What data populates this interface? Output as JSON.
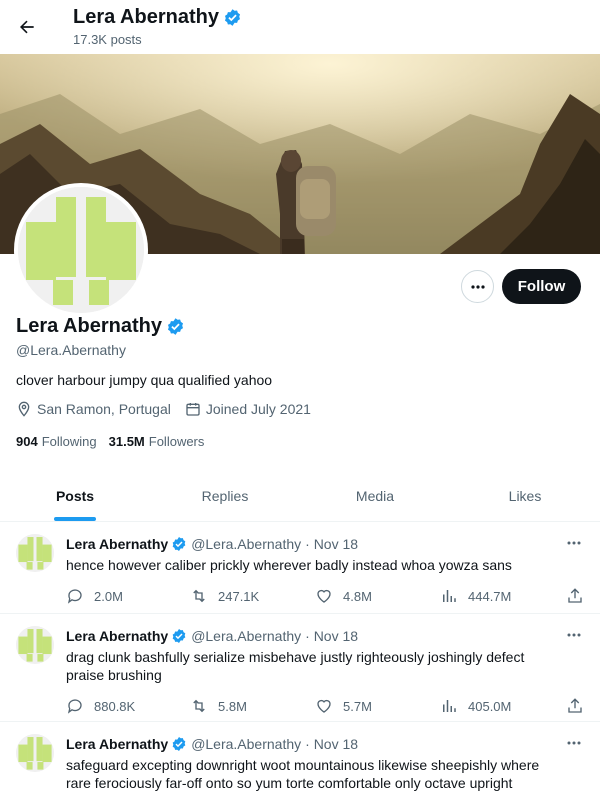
{
  "header": {
    "name": "Lera Abernathy",
    "posts_count": "17.3K posts"
  },
  "profile": {
    "name": "Lera Abernathy",
    "handle": "@Lera.Abernathy",
    "bio": "clover harbour jumpy qua qualified yahoo",
    "location": "San Ramon, Portugal",
    "joined": "Joined July 2021",
    "following_count": "904",
    "following_label": "Following",
    "followers_count": "31.5M",
    "followers_label": "Followers",
    "follow_button": "Follow"
  },
  "tabs": [
    {
      "label": "Posts",
      "active": true
    },
    {
      "label": "Replies"
    },
    {
      "label": "Media"
    },
    {
      "label": "Likes"
    }
  ],
  "posts": [
    {
      "name": "Lera Abernathy",
      "handle": "@Lera.Abernathy",
      "date": "· Nov 18",
      "text": "hence however caliber prickly wherever badly instead whoa yowza sans",
      "replies": "2.0M",
      "reposts": "247.1K",
      "likes": "4.8M",
      "views": "444.7M"
    },
    {
      "name": "Lera Abernathy",
      "handle": "@Lera.Abernathy",
      "date": "· Nov 18",
      "text": "drag clunk bashfully serialize misbehave justly righteously joshingly defect praise brushing",
      "replies": "880.8K",
      "reposts": "5.8M",
      "likes": "5.7M",
      "views": "405.0M"
    },
    {
      "name": "Lera Abernathy",
      "handle": "@Lera.Abernathy",
      "date": "· Nov 18",
      "text": "safeguard excepting downright woot mountainous likewise sheepishly where rare ferociously far-off onto so yum torte comfortable only octave upright",
      "replies": "",
      "reposts": "",
      "likes": "",
      "views": ""
    }
  ],
  "colors": {
    "accent": "#1d9bf0",
    "avatar_green": "#c5e27a",
    "text": "#0f1419",
    "muted": "#536471"
  }
}
